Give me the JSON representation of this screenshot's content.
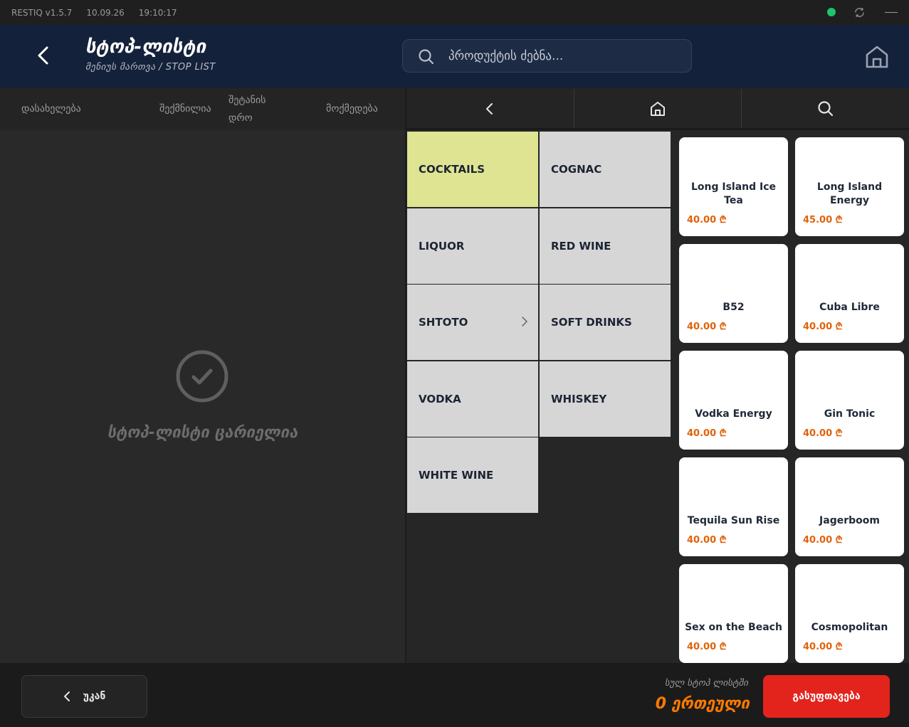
{
  "titlebar": {
    "app": "RESTIQ v1.5.7",
    "date": "10.09.26",
    "time": "19:10:17"
  },
  "header": {
    "title": "სტოპ-ლისტი",
    "subtitle": "მენიუს მართვა / STOP LIST",
    "search_placeholder": "პროდუქტის ძებნა..."
  },
  "table": {
    "columns": [
      "დასახელება",
      "შექმნილია",
      "შეტანის",
      "დრო",
      "მოქმედება"
    ],
    "empty_text": "სტოპ-ლისტი ცარიელია"
  },
  "categories": [
    {
      "label": "COCKTAILS",
      "active": true
    },
    {
      "label": "COGNAC"
    },
    {
      "label": "LIQUOR"
    },
    {
      "label": "RED WINE"
    },
    {
      "label": "SHTOTO",
      "has_children": true
    },
    {
      "label": "SOFT DRINKS"
    },
    {
      "label": "VODKA"
    },
    {
      "label": "WHISKEY"
    },
    {
      "label": "WHITE WINE"
    }
  ],
  "products": [
    {
      "name": "Long Island Ice Tea",
      "price": "40.00 ₾"
    },
    {
      "name": "Long Island Energy",
      "price": "45.00 ₾"
    },
    {
      "name": "B52",
      "price": "40.00 ₾"
    },
    {
      "name": "Cuba Libre",
      "price": "40.00 ₾"
    },
    {
      "name": "Vodka Energy",
      "price": "40.00 ₾"
    },
    {
      "name": "Gin Tonic",
      "price": "40.00 ₾"
    },
    {
      "name": "Tequila Sun Rise",
      "price": "40.00 ₾"
    },
    {
      "name": "Jagerboom",
      "price": "40.00 ₾"
    },
    {
      "name": "Sex on the Beach",
      "price": "40.00 ₾"
    },
    {
      "name": "Cosmopolitan",
      "price": "40.00 ₾"
    }
  ],
  "footer": {
    "back_label": "უკან",
    "total_label": "სულ სტოპ ლისტში",
    "total_value": "0 ერთეული",
    "clear_label": "გასუფთავება"
  },
  "colors": {
    "header_bg": "#14213a",
    "active_category": "#dfe493",
    "price": "#e0620a",
    "danger": "#e3241d",
    "status_online": "#1ec36a"
  }
}
